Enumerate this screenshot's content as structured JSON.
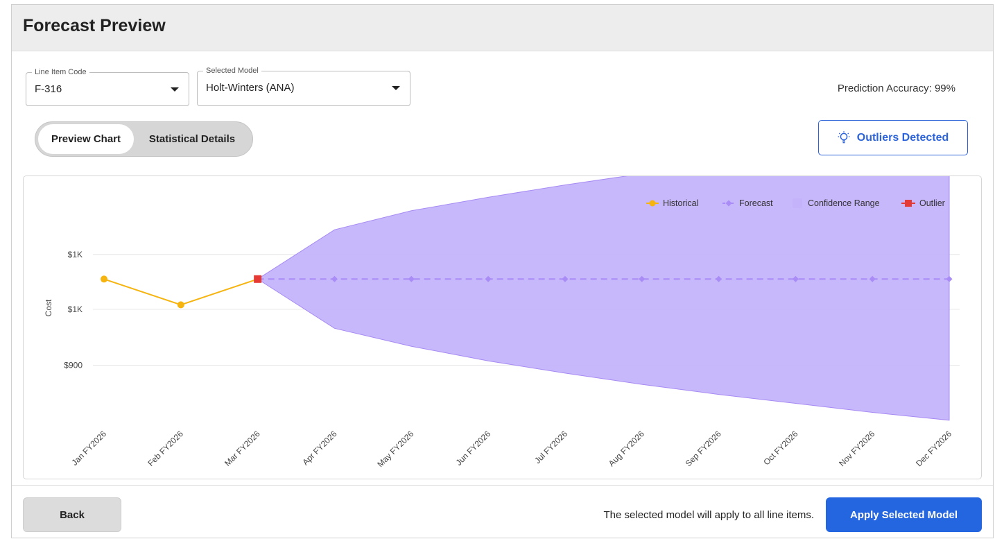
{
  "header": {
    "title": "Forecast Preview"
  },
  "line_item": {
    "label": "Line Item Code",
    "value": "F-316"
  },
  "model": {
    "label": "Selected Model",
    "value": "Holt-Winters (ANA)"
  },
  "accuracy": {
    "text": "Prediction Accuracy: 99%"
  },
  "tabs": {
    "active": "Preview Chart",
    "inactive": "Statistical Details"
  },
  "outliers_button": {
    "label": "Outliers Detected",
    "icon": "lightbulb-icon",
    "color": "#2c63d9"
  },
  "chart_data": {
    "type": "line",
    "ylabel": "Cost",
    "xlabel": "",
    "y_tick_labels": [
      "$1K",
      "$1K",
      "$900"
    ],
    "categories": [
      "Jan FY2026",
      "Feb FY2026",
      "Mar FY2026",
      "Apr FY2026",
      "May FY2026",
      "Jun FY2026",
      "Jul FY2026",
      "Aug FY2026",
      "Sep FY2026",
      "Oct FY2026",
      "Nov FY2026",
      "Dec FY2026"
    ],
    "ylim": [
      850,
      1050
    ],
    "legend": {
      "placement": "top-right",
      "items": [
        "Historical",
        "Forecast",
        "Confidence Range",
        "Outlier"
      ]
    },
    "series": [
      {
        "name": "Historical",
        "color": "#f5b40f",
        "values": [
          978,
          955,
          978,
          null,
          null,
          null,
          null,
          null,
          null,
          null,
          null,
          null
        ]
      },
      {
        "name": "Forecast",
        "color": "#a98cf5",
        "values": [
          null,
          null,
          978,
          978,
          978,
          978,
          978,
          978,
          978,
          978,
          978,
          978
        ]
      },
      {
        "name": "Confidence Range",
        "color": "#c4b3fb",
        "upper": [
          null,
          null,
          978,
          1022,
          1039,
          1051,
          1062,
          1072,
          1081,
          1089,
          1097,
          1105
        ],
        "lower": [
          null,
          null,
          978,
          934,
          918,
          905,
          894,
          884,
          875,
          867,
          859,
          852
        ]
      },
      {
        "name": "Outlier",
        "color": "#e53935",
        "points": [
          {
            "x": "Mar FY2026",
            "y": 978
          }
        ]
      }
    ]
  },
  "footer": {
    "back_label": "Back",
    "note": "The selected model will apply to all line items.",
    "apply_label": "Apply Selected Model",
    "apply_color": "#2465e0"
  }
}
